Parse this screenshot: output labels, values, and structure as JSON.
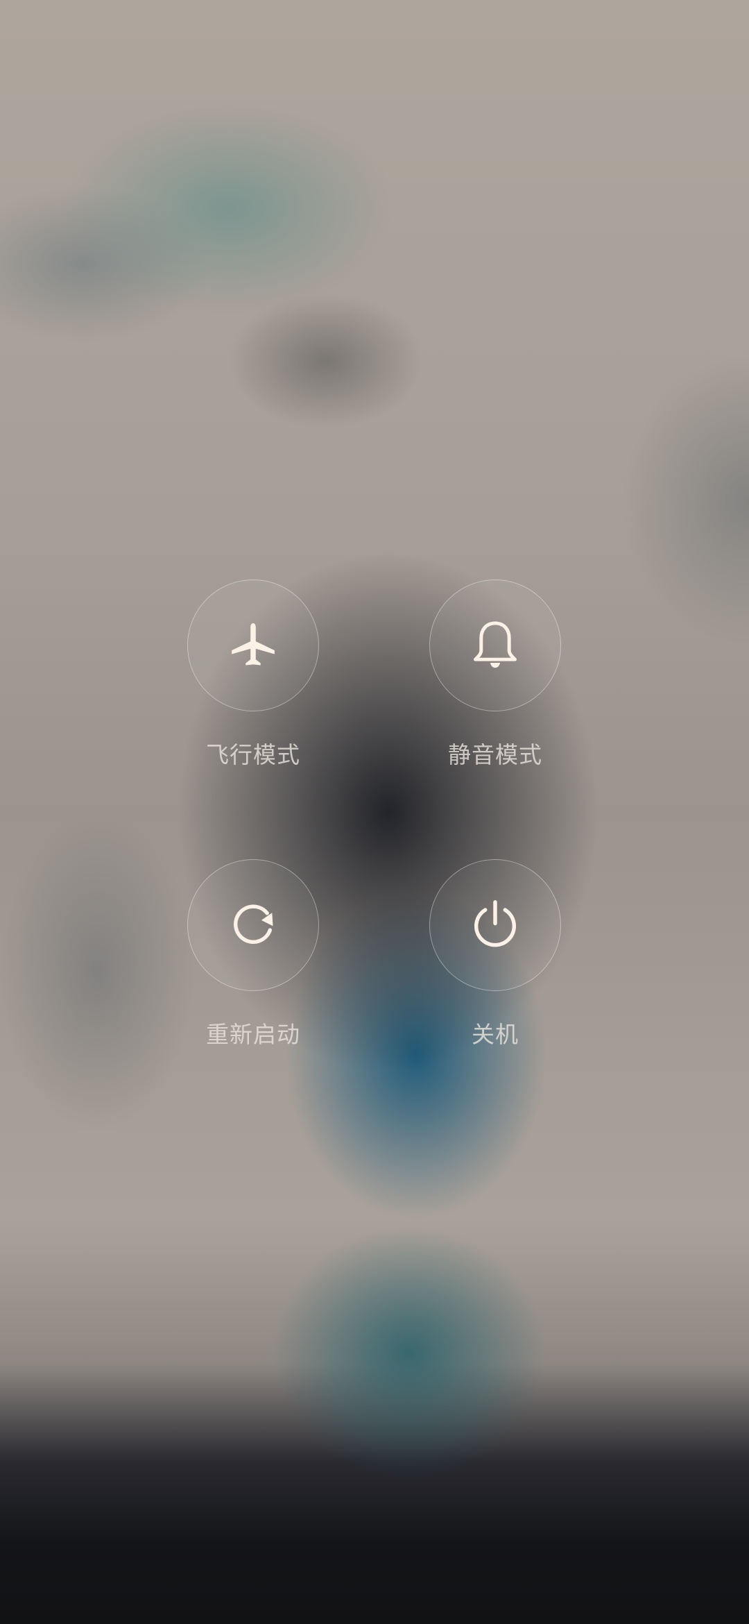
{
  "power_menu": {
    "airplane": {
      "label": "飞行模式",
      "icon": "airplane-icon"
    },
    "silent": {
      "label": "静音模式",
      "icon": "bell-icon"
    },
    "reboot": {
      "label": "重新启动",
      "icon": "restart-icon"
    },
    "power_off": {
      "label": "关机",
      "icon": "power-icon"
    }
  },
  "colors": {
    "icon": "#fbf1e7",
    "label": "#e8e2dc",
    "ring": "#ffffff"
  }
}
